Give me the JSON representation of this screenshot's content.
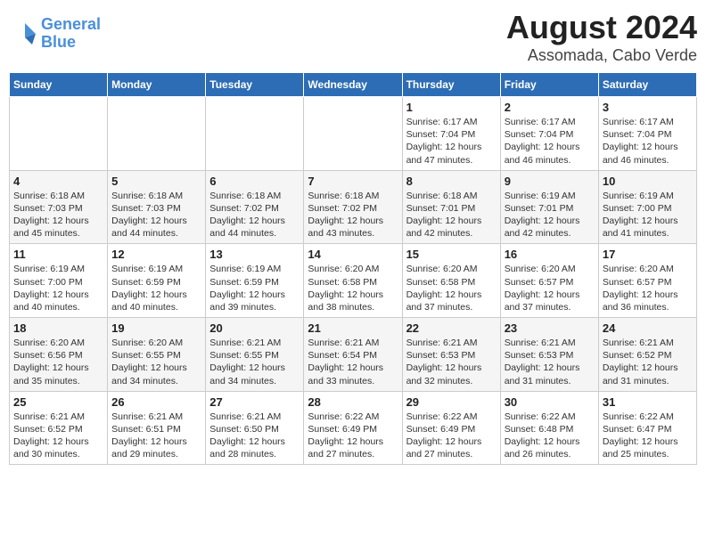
{
  "logo": {
    "line1": "General",
    "line2": "Blue"
  },
  "title": "August 2024",
  "subtitle": "Assomada, Cabo Verde",
  "days_of_week": [
    "Sunday",
    "Monday",
    "Tuesday",
    "Wednesday",
    "Thursday",
    "Friday",
    "Saturday"
  ],
  "weeks": [
    [
      {
        "day": "",
        "info": ""
      },
      {
        "day": "",
        "info": ""
      },
      {
        "day": "",
        "info": ""
      },
      {
        "day": "",
        "info": ""
      },
      {
        "day": "1",
        "info": "Sunrise: 6:17 AM\nSunset: 7:04 PM\nDaylight: 12 hours\nand 47 minutes."
      },
      {
        "day": "2",
        "info": "Sunrise: 6:17 AM\nSunset: 7:04 PM\nDaylight: 12 hours\nand 46 minutes."
      },
      {
        "day": "3",
        "info": "Sunrise: 6:17 AM\nSunset: 7:04 PM\nDaylight: 12 hours\nand 46 minutes."
      }
    ],
    [
      {
        "day": "4",
        "info": "Sunrise: 6:18 AM\nSunset: 7:03 PM\nDaylight: 12 hours\nand 45 minutes."
      },
      {
        "day": "5",
        "info": "Sunrise: 6:18 AM\nSunset: 7:03 PM\nDaylight: 12 hours\nand 44 minutes."
      },
      {
        "day": "6",
        "info": "Sunrise: 6:18 AM\nSunset: 7:02 PM\nDaylight: 12 hours\nand 44 minutes."
      },
      {
        "day": "7",
        "info": "Sunrise: 6:18 AM\nSunset: 7:02 PM\nDaylight: 12 hours\nand 43 minutes."
      },
      {
        "day": "8",
        "info": "Sunrise: 6:18 AM\nSunset: 7:01 PM\nDaylight: 12 hours\nand 42 minutes."
      },
      {
        "day": "9",
        "info": "Sunrise: 6:19 AM\nSunset: 7:01 PM\nDaylight: 12 hours\nand 42 minutes."
      },
      {
        "day": "10",
        "info": "Sunrise: 6:19 AM\nSunset: 7:00 PM\nDaylight: 12 hours\nand 41 minutes."
      }
    ],
    [
      {
        "day": "11",
        "info": "Sunrise: 6:19 AM\nSunset: 7:00 PM\nDaylight: 12 hours\nand 40 minutes."
      },
      {
        "day": "12",
        "info": "Sunrise: 6:19 AM\nSunset: 6:59 PM\nDaylight: 12 hours\nand 40 minutes."
      },
      {
        "day": "13",
        "info": "Sunrise: 6:19 AM\nSunset: 6:59 PM\nDaylight: 12 hours\nand 39 minutes."
      },
      {
        "day": "14",
        "info": "Sunrise: 6:20 AM\nSunset: 6:58 PM\nDaylight: 12 hours\nand 38 minutes."
      },
      {
        "day": "15",
        "info": "Sunrise: 6:20 AM\nSunset: 6:58 PM\nDaylight: 12 hours\nand 37 minutes."
      },
      {
        "day": "16",
        "info": "Sunrise: 6:20 AM\nSunset: 6:57 PM\nDaylight: 12 hours\nand 37 minutes."
      },
      {
        "day": "17",
        "info": "Sunrise: 6:20 AM\nSunset: 6:57 PM\nDaylight: 12 hours\nand 36 minutes."
      }
    ],
    [
      {
        "day": "18",
        "info": "Sunrise: 6:20 AM\nSunset: 6:56 PM\nDaylight: 12 hours\nand 35 minutes."
      },
      {
        "day": "19",
        "info": "Sunrise: 6:20 AM\nSunset: 6:55 PM\nDaylight: 12 hours\nand 34 minutes."
      },
      {
        "day": "20",
        "info": "Sunrise: 6:21 AM\nSunset: 6:55 PM\nDaylight: 12 hours\nand 34 minutes."
      },
      {
        "day": "21",
        "info": "Sunrise: 6:21 AM\nSunset: 6:54 PM\nDaylight: 12 hours\nand 33 minutes."
      },
      {
        "day": "22",
        "info": "Sunrise: 6:21 AM\nSunset: 6:53 PM\nDaylight: 12 hours\nand 32 minutes."
      },
      {
        "day": "23",
        "info": "Sunrise: 6:21 AM\nSunset: 6:53 PM\nDaylight: 12 hours\nand 31 minutes."
      },
      {
        "day": "24",
        "info": "Sunrise: 6:21 AM\nSunset: 6:52 PM\nDaylight: 12 hours\nand 31 minutes."
      }
    ],
    [
      {
        "day": "25",
        "info": "Sunrise: 6:21 AM\nSunset: 6:52 PM\nDaylight: 12 hours\nand 30 minutes."
      },
      {
        "day": "26",
        "info": "Sunrise: 6:21 AM\nSunset: 6:51 PM\nDaylight: 12 hours\nand 29 minutes."
      },
      {
        "day": "27",
        "info": "Sunrise: 6:21 AM\nSunset: 6:50 PM\nDaylight: 12 hours\nand 28 minutes."
      },
      {
        "day": "28",
        "info": "Sunrise: 6:22 AM\nSunset: 6:49 PM\nDaylight: 12 hours\nand 27 minutes."
      },
      {
        "day": "29",
        "info": "Sunrise: 6:22 AM\nSunset: 6:49 PM\nDaylight: 12 hours\nand 27 minutes."
      },
      {
        "day": "30",
        "info": "Sunrise: 6:22 AM\nSunset: 6:48 PM\nDaylight: 12 hours\nand 26 minutes."
      },
      {
        "day": "31",
        "info": "Sunrise: 6:22 AM\nSunset: 6:47 PM\nDaylight: 12 hours\nand 25 minutes."
      }
    ]
  ]
}
